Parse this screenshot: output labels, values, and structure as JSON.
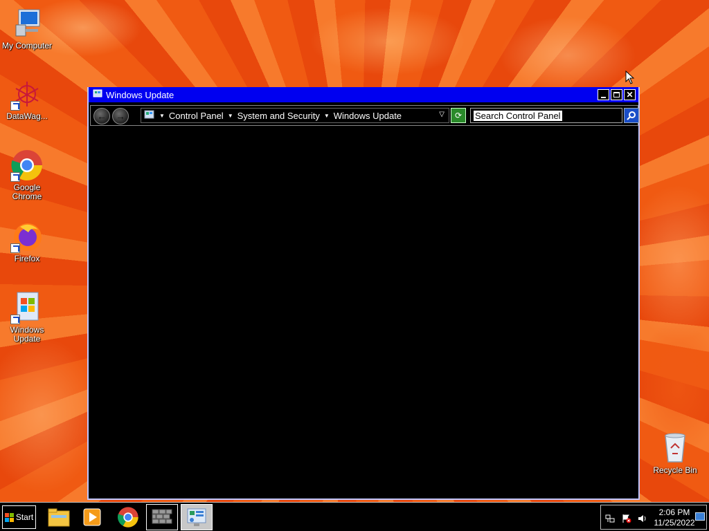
{
  "desktop": {
    "icons": [
      {
        "label": "My Computer",
        "icon": "computer-icon"
      },
      {
        "label": "DataWag...",
        "icon": "datawag-icon"
      },
      {
        "label": "Google Chrome",
        "icon": "chrome-icon"
      },
      {
        "label": "Firefox",
        "icon": "firefox-icon"
      },
      {
        "label": "Windows Update",
        "icon": "windows-update-icon"
      },
      {
        "label": "Recycle Bin",
        "icon": "recycle-bin-icon"
      }
    ]
  },
  "window": {
    "title": "Windows Update",
    "controls": {
      "minimize": "minimize-icon",
      "maximize": "maximize-icon",
      "close": "close-icon"
    },
    "breadcrumb": [
      "Control Panel",
      "System and Security",
      "Windows Update"
    ],
    "search": {
      "placeholder": "Search Control Panel"
    }
  },
  "taskbar": {
    "start_label": "Start",
    "pinned": [
      "file-explorer-icon",
      "media-player-icon",
      "chrome-icon",
      "firewall-icon",
      "control-panel-icon"
    ],
    "tray": {
      "time": "2:06 PM",
      "date": "11/25/2022"
    }
  },
  "colors": {
    "titlebar": "#0000f0",
    "window_bg": "#000000",
    "taskbar_bg": "#000000",
    "wallpaper": "#ef5a14"
  }
}
